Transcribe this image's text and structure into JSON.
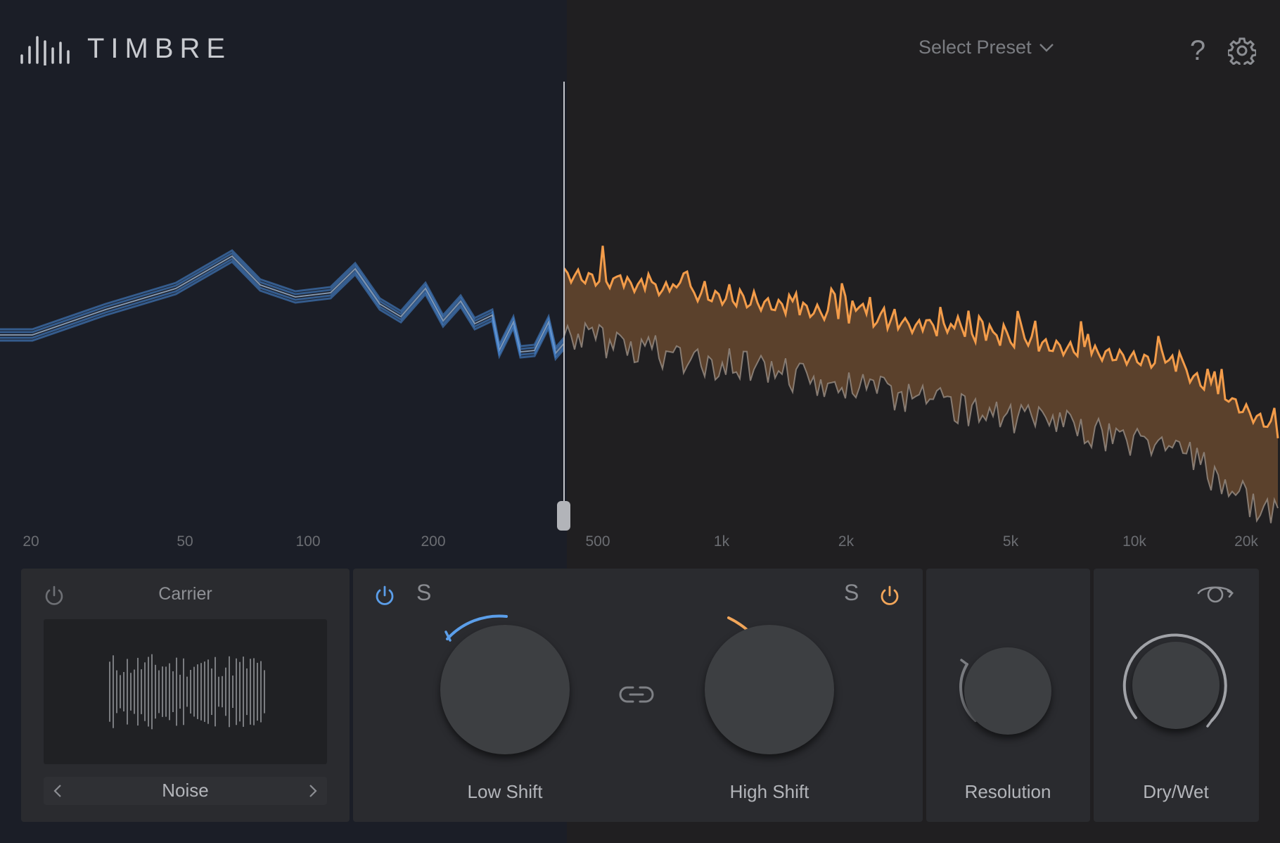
{
  "app": {
    "title": "TIMBRE"
  },
  "header": {
    "preset_label": "Select Preset",
    "help_label": "?",
    "icons": [
      "logo-bars-icon",
      "chevron-down-icon",
      "gear-icon"
    ]
  },
  "spectrum": {
    "frequency_labels": [
      "20",
      "50",
      "100",
      "200",
      "500",
      "1k",
      "2k",
      "5k",
      "10k",
      "20k"
    ],
    "low_color": "#4a90e2",
    "high_color": "#f39c4a"
  },
  "carrier": {
    "title": "Carrier",
    "source": "Noise",
    "enabled": false,
    "icons": [
      "power-icon",
      "chevron-left-icon",
      "chevron-right-icon"
    ]
  },
  "shift": {
    "low": {
      "label": "Low Shift",
      "solo": "S",
      "enabled": true,
      "color": "#5b9ee9"
    },
    "high": {
      "label": "High Shift",
      "solo": "S",
      "enabled": true,
      "color": "#f2a65a"
    },
    "link_icon": "link-icon"
  },
  "resolution": {
    "label": "Resolution"
  },
  "drywet": {
    "label": "Dry/Wet",
    "icon": "stereo-rotate-icon"
  }
}
